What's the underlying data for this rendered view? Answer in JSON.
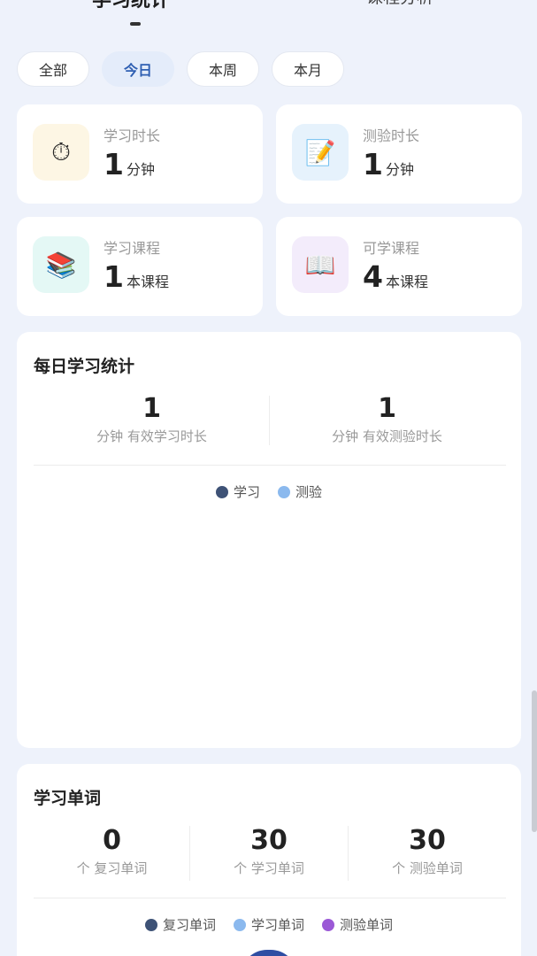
{
  "header": {
    "left_tab": "学习统计",
    "right_tab": "课程分析"
  },
  "filters": [
    {
      "label": "全部",
      "active": false
    },
    {
      "label": "今日",
      "active": true
    },
    {
      "label": "本周",
      "active": false
    },
    {
      "label": "本月",
      "active": false
    }
  ],
  "stats": [
    {
      "label": "学习时长",
      "value": "1",
      "unit": "分钟",
      "icon": "stopwatch-icon",
      "glyph": "⏱",
      "bg": "#fdf6e4"
    },
    {
      "label": "测验时长",
      "value": "1",
      "unit": "分钟",
      "icon": "memo-icon",
      "glyph": "📝",
      "bg": "#e6f2fc"
    },
    {
      "label": "学习课程",
      "value": "1",
      "unit": "本课程",
      "icon": "books-icon",
      "glyph": "📚",
      "bg": "#e4f8f5"
    },
    {
      "label": "可学课程",
      "value": "4",
      "unit": "本课程",
      "icon": "open-book-icon",
      "glyph": "📖",
      "bg": "#f3ecfb"
    }
  ],
  "daily": {
    "title": "每日学习统计",
    "metrics": [
      {
        "value": "1",
        "label": "分钟 有效学习时长"
      },
      {
        "value": "1",
        "label": "分钟 有效测验时长"
      }
    ],
    "legend": [
      {
        "label": "学习",
        "color": "#3e5276"
      },
      {
        "label": "测验",
        "color": "#8bb9ee"
      }
    ]
  },
  "words": {
    "title": "学习单词",
    "metrics": [
      {
        "value": "0",
        "label": "个 复习单词"
      },
      {
        "value": "30",
        "label": "个 学习单词"
      },
      {
        "value": "30",
        "label": "个 测验单词"
      }
    ],
    "legend": [
      {
        "label": "复习单词",
        "color": "#3e5276"
      },
      {
        "label": "学习单词",
        "color": "#8bb9ee"
      },
      {
        "label": "测验单词",
        "color": "#9b59d6"
      }
    ]
  }
}
